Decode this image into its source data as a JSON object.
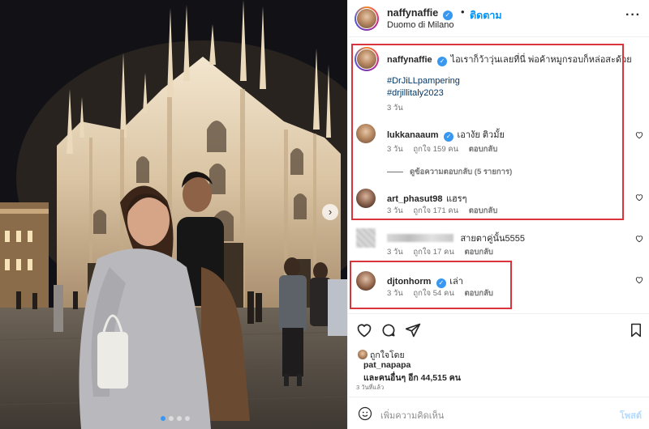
{
  "post": {
    "username": "naffynaffie",
    "follow_label": "ติดตาม",
    "separator": "•",
    "location": "Duomo di Milano",
    "more_icon": "more-horizontal-icon"
  },
  "caption": {
    "username": "naffynaffie",
    "text": "ไอเราก็ว้าวุ่นเลยที่นี่ พ่อค้าหมูกรอบก็หล่อสะด้วย",
    "hashtags": [
      "#DrJiLLpampering",
      "#drjillitaly2023"
    ],
    "time": "3 วัน"
  },
  "comments": [
    {
      "username": "lukkanaaum",
      "verified": true,
      "text": "เอางัย ติวมั้ย",
      "time": "3 วัน",
      "likes": "ถูกใจ 159 คน",
      "reply": "ตอบกลับ"
    },
    {
      "view_replies": "ดูข้อความตอบกลับ (5 รายการ)"
    },
    {
      "username": "art_phasut98",
      "verified": false,
      "text": "แฮรๆ",
      "time": "3 วัน",
      "likes": "ถูกใจ 171 คน",
      "reply": "ตอบกลับ"
    },
    {
      "username": "",
      "verified": false,
      "text": "สายตาคู่นั้น5555",
      "time": "3 วัน",
      "likes": "ถูกใจ 17 คน",
      "reply": "ตอบกลับ"
    },
    {
      "username": "djtonhorm",
      "verified": true,
      "text": "เล่า",
      "time": "3 วัน",
      "likes": "ถูกใจ 54 คน",
      "reply": "ตอบกลับ"
    }
  ],
  "likes": {
    "label": "ถูกใจโดย",
    "user": "pat_napapa",
    "others": "และคนอื่นๆ อีก 44,515 คน",
    "post_time": "3 วันที่แล้ว"
  },
  "composer": {
    "placeholder": "เพิ่มความคิดเห็น",
    "post_label": "โพสต์"
  },
  "colors": {
    "accent": "#0095f6",
    "verified": "#3897f0",
    "highlight_box": "#d9333b"
  },
  "carousel": {
    "slides": 4,
    "active": 1
  }
}
